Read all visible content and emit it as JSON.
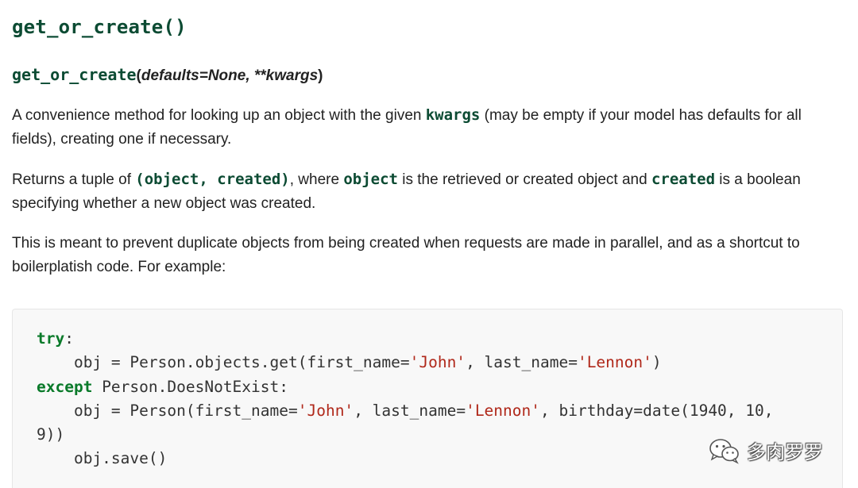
{
  "heading": {
    "title": "get_or_create()"
  },
  "signature": {
    "function_name": "get_or_create",
    "open_paren": "(",
    "params": "defaults=None, **kwargs",
    "close_paren": ")"
  },
  "para1": {
    "text_before": "A convenience method for looking up an object with the given ",
    "code": "kwargs",
    "text_after": " (may be empty if your model has defaults for all fields), creating one if necessary."
  },
  "para2": {
    "text_1": "Returns a tuple of ",
    "code_1": "(object, created)",
    "text_2": ", where ",
    "code_2": "object",
    "text_3": " is the retrieved or created object and ",
    "code_3": "created",
    "text_4": " is a boolean specifying whether a new object was created."
  },
  "para3": {
    "text": "This is meant to prevent duplicate objects from being created when requests are made in parallel, and as a shortcut to boilerplatish code. For example:"
  },
  "code_example": {
    "line1_kw": "try",
    "line1_rest": ":",
    "line2_a": "    obj = Person.objects.get(first_name=",
    "line2_s1": "'John'",
    "line2_b": ", last_name=",
    "line2_s2": "'Lennon'",
    "line2_c": ")",
    "line3_kw": "except",
    "line3_rest": " Person.DoesNotExist:",
    "line4_a": "    obj = Person(first_name=",
    "line4_s1": "'John'",
    "line4_b": ", last_name=",
    "line4_s2": "'Lennon'",
    "line4_c": ", birthday=date(1940, 10,",
    "line5": "9))",
    "line6": "    obj.save()"
  },
  "watermark": {
    "icon": "wechat-icon",
    "text": "多肉罗罗"
  },
  "colors": {
    "code_accent": "#0c4b33",
    "keyword": "#0a7a2a",
    "string": "#b0281a",
    "code_bg": "#f8f8f8"
  }
}
